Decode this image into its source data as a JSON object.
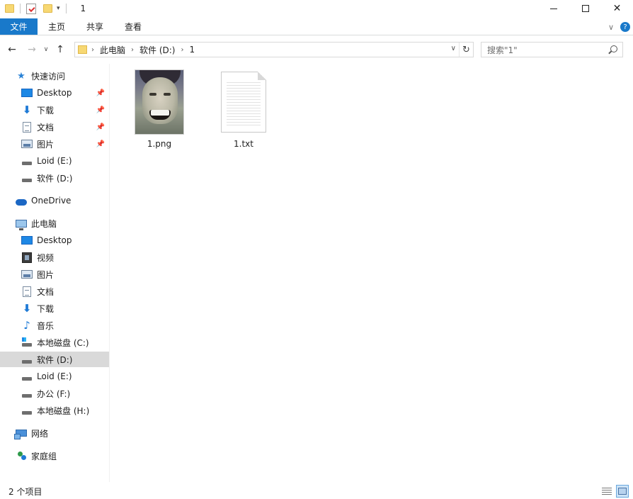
{
  "window": {
    "title": "1",
    "minimize_icon": "minimize-icon",
    "maximize_icon": "maximize-icon",
    "close_glyph": "✕"
  },
  "ribbon": {
    "tabs": [
      {
        "label": "文件"
      },
      {
        "label": "主页"
      },
      {
        "label": "共享"
      },
      {
        "label": "查看"
      }
    ],
    "expand_glyph": "∨",
    "help_glyph": "?"
  },
  "navigation": {
    "back_glyph": "←",
    "forward_glyph": "→",
    "recent_glyph": "∨",
    "up_glyph": "↑",
    "breadcrumbs": [
      {
        "label": "此电脑"
      },
      {
        "label": "软件 (D:)"
      },
      {
        "label": "1"
      }
    ],
    "crumb_sep_glyph": "›",
    "address_dropdown_glyph": "∨",
    "refresh_glyph": "↻",
    "search_placeholder": "搜索\"1\""
  },
  "sidebar": {
    "quick_access": {
      "label": "快速访问",
      "items": [
        {
          "label": "Desktop",
          "icon": "desktop-icon",
          "pinned": true
        },
        {
          "label": "下载",
          "icon": "download-icon",
          "pinned": true
        },
        {
          "label": "文档",
          "icon": "document-icon",
          "pinned": true
        },
        {
          "label": "图片",
          "icon": "pictures-icon",
          "pinned": true
        },
        {
          "label": "Loid (E:)",
          "icon": "drive-icon",
          "pinned": false
        },
        {
          "label": "软件 (D:)",
          "icon": "drive-icon",
          "pinned": false
        }
      ]
    },
    "onedrive": {
      "label": "OneDrive"
    },
    "this_pc": {
      "label": "此电脑",
      "items": [
        {
          "label": "Desktop"
        },
        {
          "label": "视频"
        },
        {
          "label": "图片"
        },
        {
          "label": "文档"
        },
        {
          "label": "下载"
        },
        {
          "label": "音乐"
        },
        {
          "label": "本地磁盘 (C:)"
        },
        {
          "label": "软件 (D:)",
          "selected": true
        },
        {
          "label": "Loid (E:)"
        },
        {
          "label": "办公 (F:)"
        },
        {
          "label": "本地磁盘 (H:)"
        }
      ]
    },
    "network": {
      "label": "网络"
    },
    "homegroup": {
      "label": "家庭组"
    },
    "pin_glyph": "📌"
  },
  "files": [
    {
      "name": "1.png",
      "type": "image"
    },
    {
      "name": "1.txt",
      "type": "text"
    }
  ],
  "status": {
    "item_count": "2 个项目"
  },
  "colors": {
    "accent": "#1979ca",
    "selected_bg": "#d9d9d9"
  }
}
